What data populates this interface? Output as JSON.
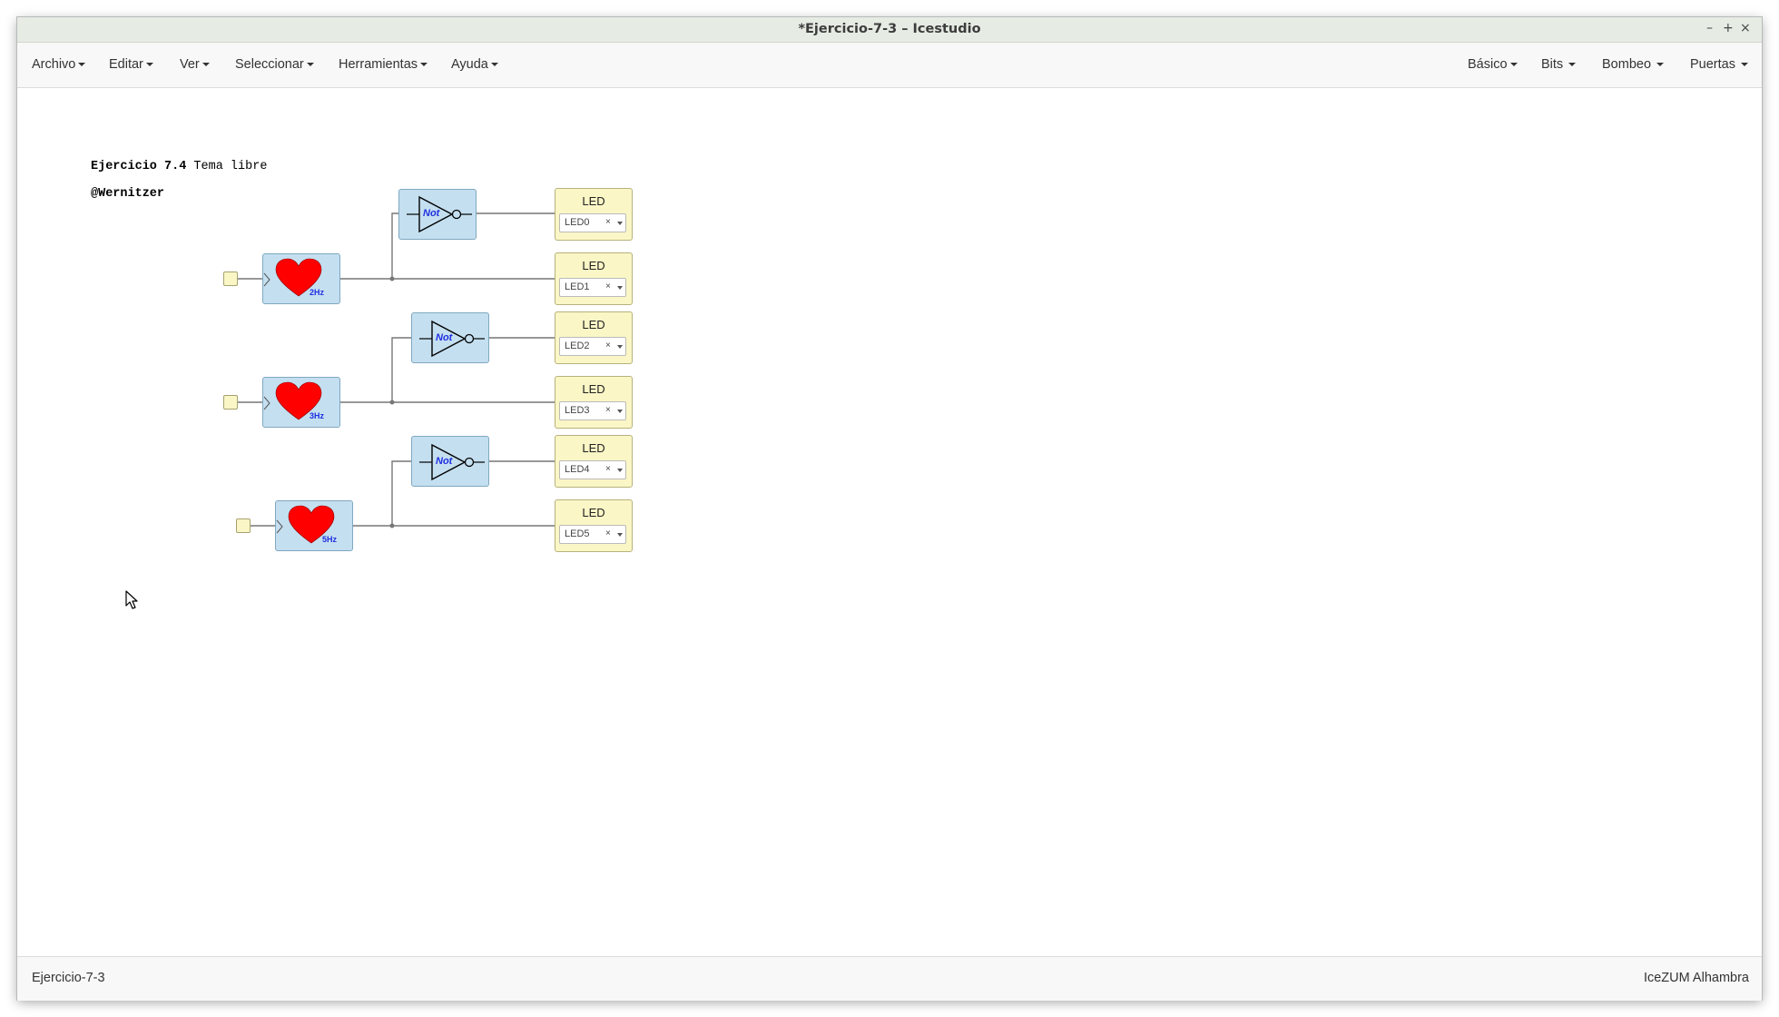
{
  "window": {
    "title": "*Ejercicio-7-3 – Icestudio",
    "controls": [
      "–",
      "+",
      "×"
    ]
  },
  "menubar": {
    "left": [
      "Archivo",
      "Editar",
      "Ver",
      "Seleccionar",
      "Herramientas",
      "Ayuda"
    ],
    "right": [
      "Básico",
      "Bits",
      "Bombeo",
      "Puertas"
    ]
  },
  "canvas": {
    "comment_line1_bold": "Ejercicio 7.4",
    "comment_line1_rest": " Tema libre",
    "comment_line2": "@Wernitzer",
    "not_label": "Not",
    "heartbeats": [
      {
        "freq": "2Hz"
      },
      {
        "freq": "3Hz"
      },
      {
        "freq": "5Hz"
      }
    ],
    "leds": [
      {
        "title": "LED",
        "pin": "LED0"
      },
      {
        "title": "LED",
        "pin": "LED1"
      },
      {
        "title": "LED",
        "pin": "LED2"
      },
      {
        "title": "LED",
        "pin": "LED3"
      },
      {
        "title": "LED",
        "pin": "LED4"
      },
      {
        "title": "LED",
        "pin": "LED5"
      }
    ],
    "pin_clear": "×"
  },
  "statusbar": {
    "project": "Ejercicio-7-3",
    "board": "IceZUM Alhambra"
  },
  "colors": {
    "block_fill": "#c4dff0",
    "led_fill": "#fbf6c6",
    "heart": "#ff0000",
    "not_text": "#1f2fe0",
    "wire": "#777777"
  }
}
